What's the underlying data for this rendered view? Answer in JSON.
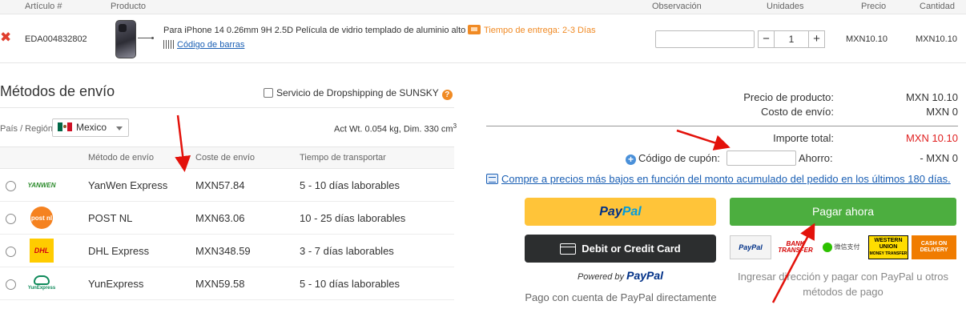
{
  "cart": {
    "headers": {
      "article": "Artículo #",
      "product": "Producto",
      "observation": "Observación",
      "units": "Unidades",
      "price": "Precio",
      "quantity": "Cantidad"
    },
    "item": {
      "sku": "EDA004832802",
      "title": "Para iPhone 14 0.26mm 9H 2.5D Película de vidrio templado de aluminio alto",
      "delivery": "Tiempo de entrega: 2-3 Días",
      "barcode": "Código de barras",
      "quantity": "1",
      "price": "MXN10.10",
      "subtotal": "MXN10.10"
    }
  },
  "shipping": {
    "title": "Métodos de envío",
    "dropshipping": "Servicio de Dropshipping de SUNSKY",
    "region_label": "País / Región:",
    "country": "Mexico",
    "weight": "Act Wt. 0.054 kg, Dim. 330 cm",
    "weight_sup": "3",
    "columns": [
      "Método de envío",
      "Coste de envío",
      "Tiempo de transportar"
    ],
    "methods": [
      {
        "logo": "YANWEN",
        "name": "YanWen Express",
        "cost": "MXN57.84",
        "time": "5 - 10 días laborables"
      },
      {
        "logo": "post nl",
        "name": "POST NL",
        "cost": "MXN63.06",
        "time": "10 - 25 días laborables"
      },
      {
        "logo": "DHL",
        "name": "DHL Express",
        "cost": "MXN348.59",
        "time": "3 - 7 días laborables"
      },
      {
        "logo": "YunExpress",
        "name": "YunExpress",
        "cost": "MXN59.58",
        "time": "5 - 10 días laborables"
      }
    ]
  },
  "summary": {
    "product_price_label": "Precio de producto:",
    "product_price": "MXN 10.10",
    "shipping_cost_label": "Costo de envío:",
    "shipping_cost": "MXN 0",
    "total_label": "Importe total:",
    "total": "MXN 10.10",
    "coupon_label": "Código de cupón:",
    "savings_label": "Ahorro:",
    "savings": "- MXN 0",
    "compare_text": "Compre a precios más bajos en función del monto acumulado del pedido en los últimos 180 días.",
    "total_color": "#e02020"
  },
  "payment": {
    "paypal_pay": "Pay",
    "paypal_pal": "Pal",
    "card_label": "Debit or Credit Card",
    "powered_by": "Powered by",
    "powered_brand": "PayPal",
    "paypal_note": "Pago con cuenta de PayPal directamente",
    "pay_now": "Pagar ahora",
    "methods": {
      "paypal": "PayPal",
      "bank": "BANK TRANSFER",
      "wechat": "微信支付",
      "western_union": "WESTERN UNION",
      "wu_sub": "MONEY TRANSFER",
      "cod": "CASH ON DELIVERY"
    },
    "methods_note": "Ingresar dirección y pagar con PayPal u otros métodos de pago",
    "paynow_color": "#4cae3f"
  }
}
